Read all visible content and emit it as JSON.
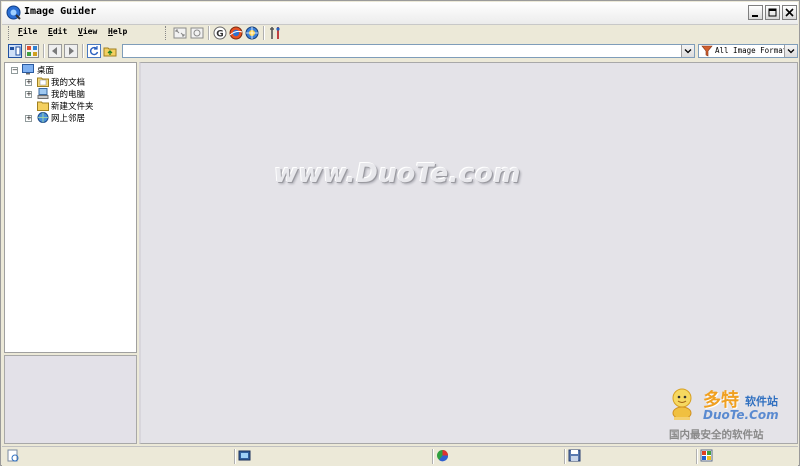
{
  "window": {
    "title": "Image Guider"
  },
  "menu": [
    {
      "mnemonic": "F",
      "rest": "ile"
    },
    {
      "mnemonic": "E",
      "rest": "dit"
    },
    {
      "mnemonic": "V",
      "rest": "iew"
    },
    {
      "mnemonic": "H",
      "rest": "elp"
    }
  ],
  "address": {
    "path": "",
    "filter": "All Image Format"
  },
  "tree": {
    "root": "桌面",
    "children": [
      "我的文档",
      "我的电脑",
      "新建文件夹",
      "网上邻居"
    ]
  },
  "watermark": "www.DuoTe.com",
  "logo": {
    "brand": "多特",
    "brand_sub": "软件站",
    "domain": "DuoTe.Com",
    "slogan": "国内最安全的软件站"
  },
  "colors": {
    "viewer_bg": "#e4e3e8",
    "chrome": "#ece9d8",
    "selection_blue": "#316ac5"
  },
  "icons": {
    "toolbar_left": [
      "explorer-view-icon",
      "thumbnail-view-icon",
      "back-icon",
      "forward-icon",
      "refresh-icon",
      "up-folder-icon"
    ],
    "toolbar_top": [
      "fit-window-icon",
      "actual-size-icon",
      "google-icon",
      "globe-orbit-icon",
      "globe-icon",
      "tools-icon"
    ],
    "status": [
      "status-image-icon",
      "status-film-icon",
      "status-color-icon",
      "status-save-icon",
      "status-window-icon"
    ]
  }
}
